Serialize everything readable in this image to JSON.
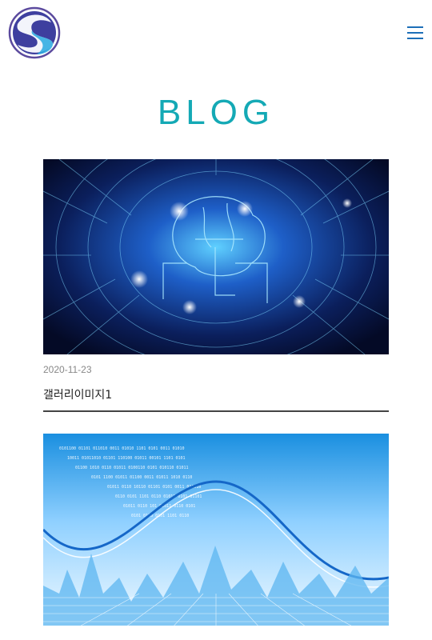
{
  "header": {
    "logo_icon": "logo-s-circle-icon",
    "menu_icon": "hamburger-menu-icon",
    "menu_color": "#1d6fb8"
  },
  "page": {
    "title": "BLOG",
    "title_color": "#14a9b5"
  },
  "posts": [
    {
      "date": "2020-11-23",
      "title": "갤러리이미지1",
      "image": "ai-brain-circuit-image"
    },
    {
      "image": "binary-world-map-wave-image"
    }
  ]
}
